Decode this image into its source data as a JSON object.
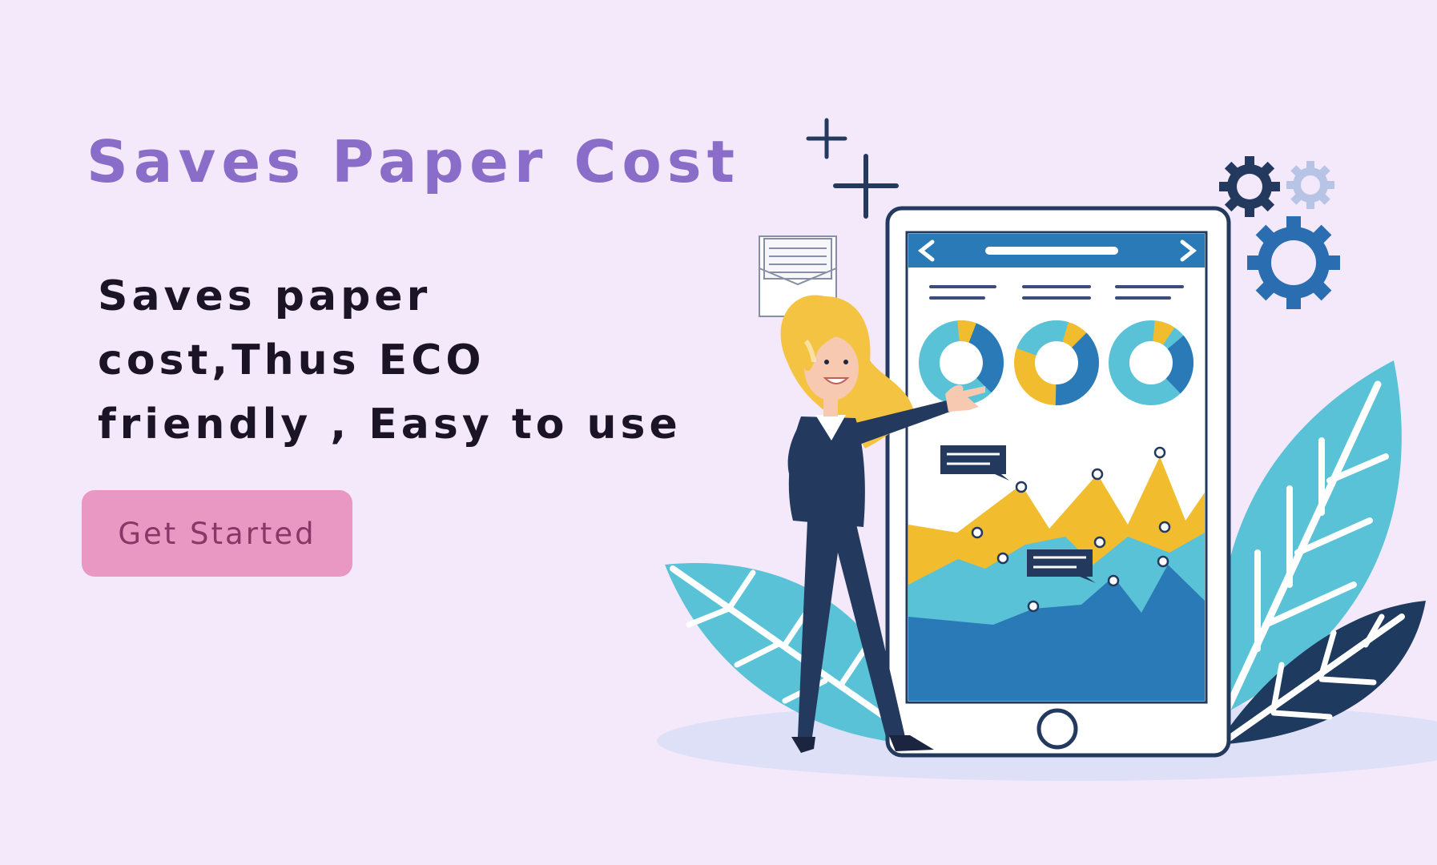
{
  "hero": {
    "title": "Saves Paper Cost",
    "description": "Saves paper cost,Thus ECO friendly , Easy to use",
    "cta_label": "Get Started"
  },
  "illustration": {
    "subject": "woman presenting analytics dashboard on tablet",
    "icons": [
      "plus-icon",
      "envelope-icon",
      "gear-icon",
      "leaf-icon",
      "donut-chart-icon",
      "area-chart-icon"
    ]
  },
  "colors": {
    "background": "#f4e9fb",
    "title": "#8a6cc9",
    "body_text": "#1b1326",
    "button_bg": "#e898c3",
    "button_text": "#873866",
    "navy": "#233a5e",
    "blue": "#2a7ab8",
    "teal": "#59c2d6",
    "yellow": "#f2bc2f"
  }
}
